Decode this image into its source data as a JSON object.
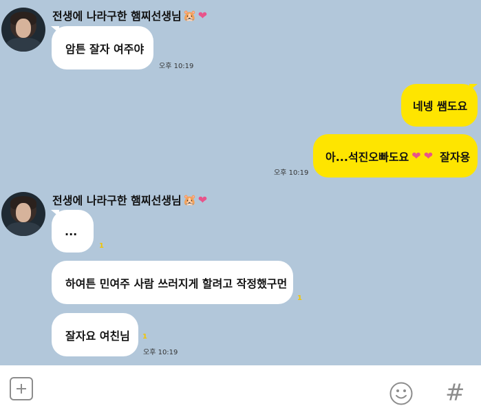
{
  "messages": [
    {
      "sender": {
        "name": "전생에 나라구한 햄찌선생님",
        "emoji": "🐹",
        "heart": "❤"
      },
      "bubbles": [
        {
          "text": "암튼 잘자 여주야",
          "time": "오후 10:19"
        }
      ]
    },
    {
      "outgoing": [
        {
          "text": "네넹 쌤도요"
        },
        {
          "text_before": "아...석진오빠도요",
          "heart1": "❤",
          "heart2": "❤",
          "text_after": "잘자용",
          "time": "오후 10:19"
        }
      ]
    },
    {
      "sender": {
        "name": "전생에 나라구한 햄찌선생님",
        "emoji": "🐹",
        "heart": "❤"
      },
      "bubbles": [
        {
          "text": "...",
          "unread": "1"
        },
        {
          "text": "하여튼 민여주 사람 쓰러지게 할려고 작정했구먼",
          "unread": "1"
        },
        {
          "text": "잘자요 여친님",
          "unread": "1",
          "time": "오후 10:19"
        }
      ]
    }
  ],
  "composer": {
    "plus_icon": "plus-icon",
    "emoji_icon": "smiley-icon",
    "hash_label": "#"
  },
  "colors": {
    "background": "#b2c7da",
    "incoming_bubble": "#ffffff",
    "outgoing_bubble": "#fee500",
    "unread": "#f2c500",
    "heart": "#e8548b"
  }
}
